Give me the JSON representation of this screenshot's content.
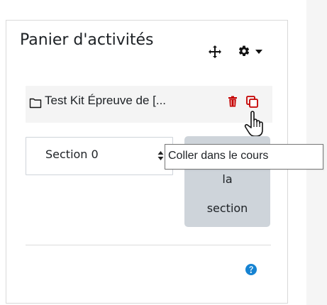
{
  "block": {
    "title": "Panier d'activités",
    "item": {
      "label": "Test Kit Épreuve de [...",
      "icon": "folder-icon"
    },
    "actions": {
      "move_icon": "move-icon",
      "settings_icon": "gear-icon",
      "menu_icon": "caret-down-icon",
      "delete_icon": "trash-icon",
      "copy_icon": "copy-icon"
    },
    "section_select": {
      "value": "Section 0"
    },
    "paste_button": {
      "line1": "la",
      "line2": "section"
    },
    "tooltip": {
      "text": "Coller dans le cours"
    },
    "help_icon": "help-icon",
    "colors": {
      "delete": "#c50000",
      "help": "#1683d2",
      "button_bg": "#ced4da",
      "row_bg": "#f4f4f4"
    }
  }
}
